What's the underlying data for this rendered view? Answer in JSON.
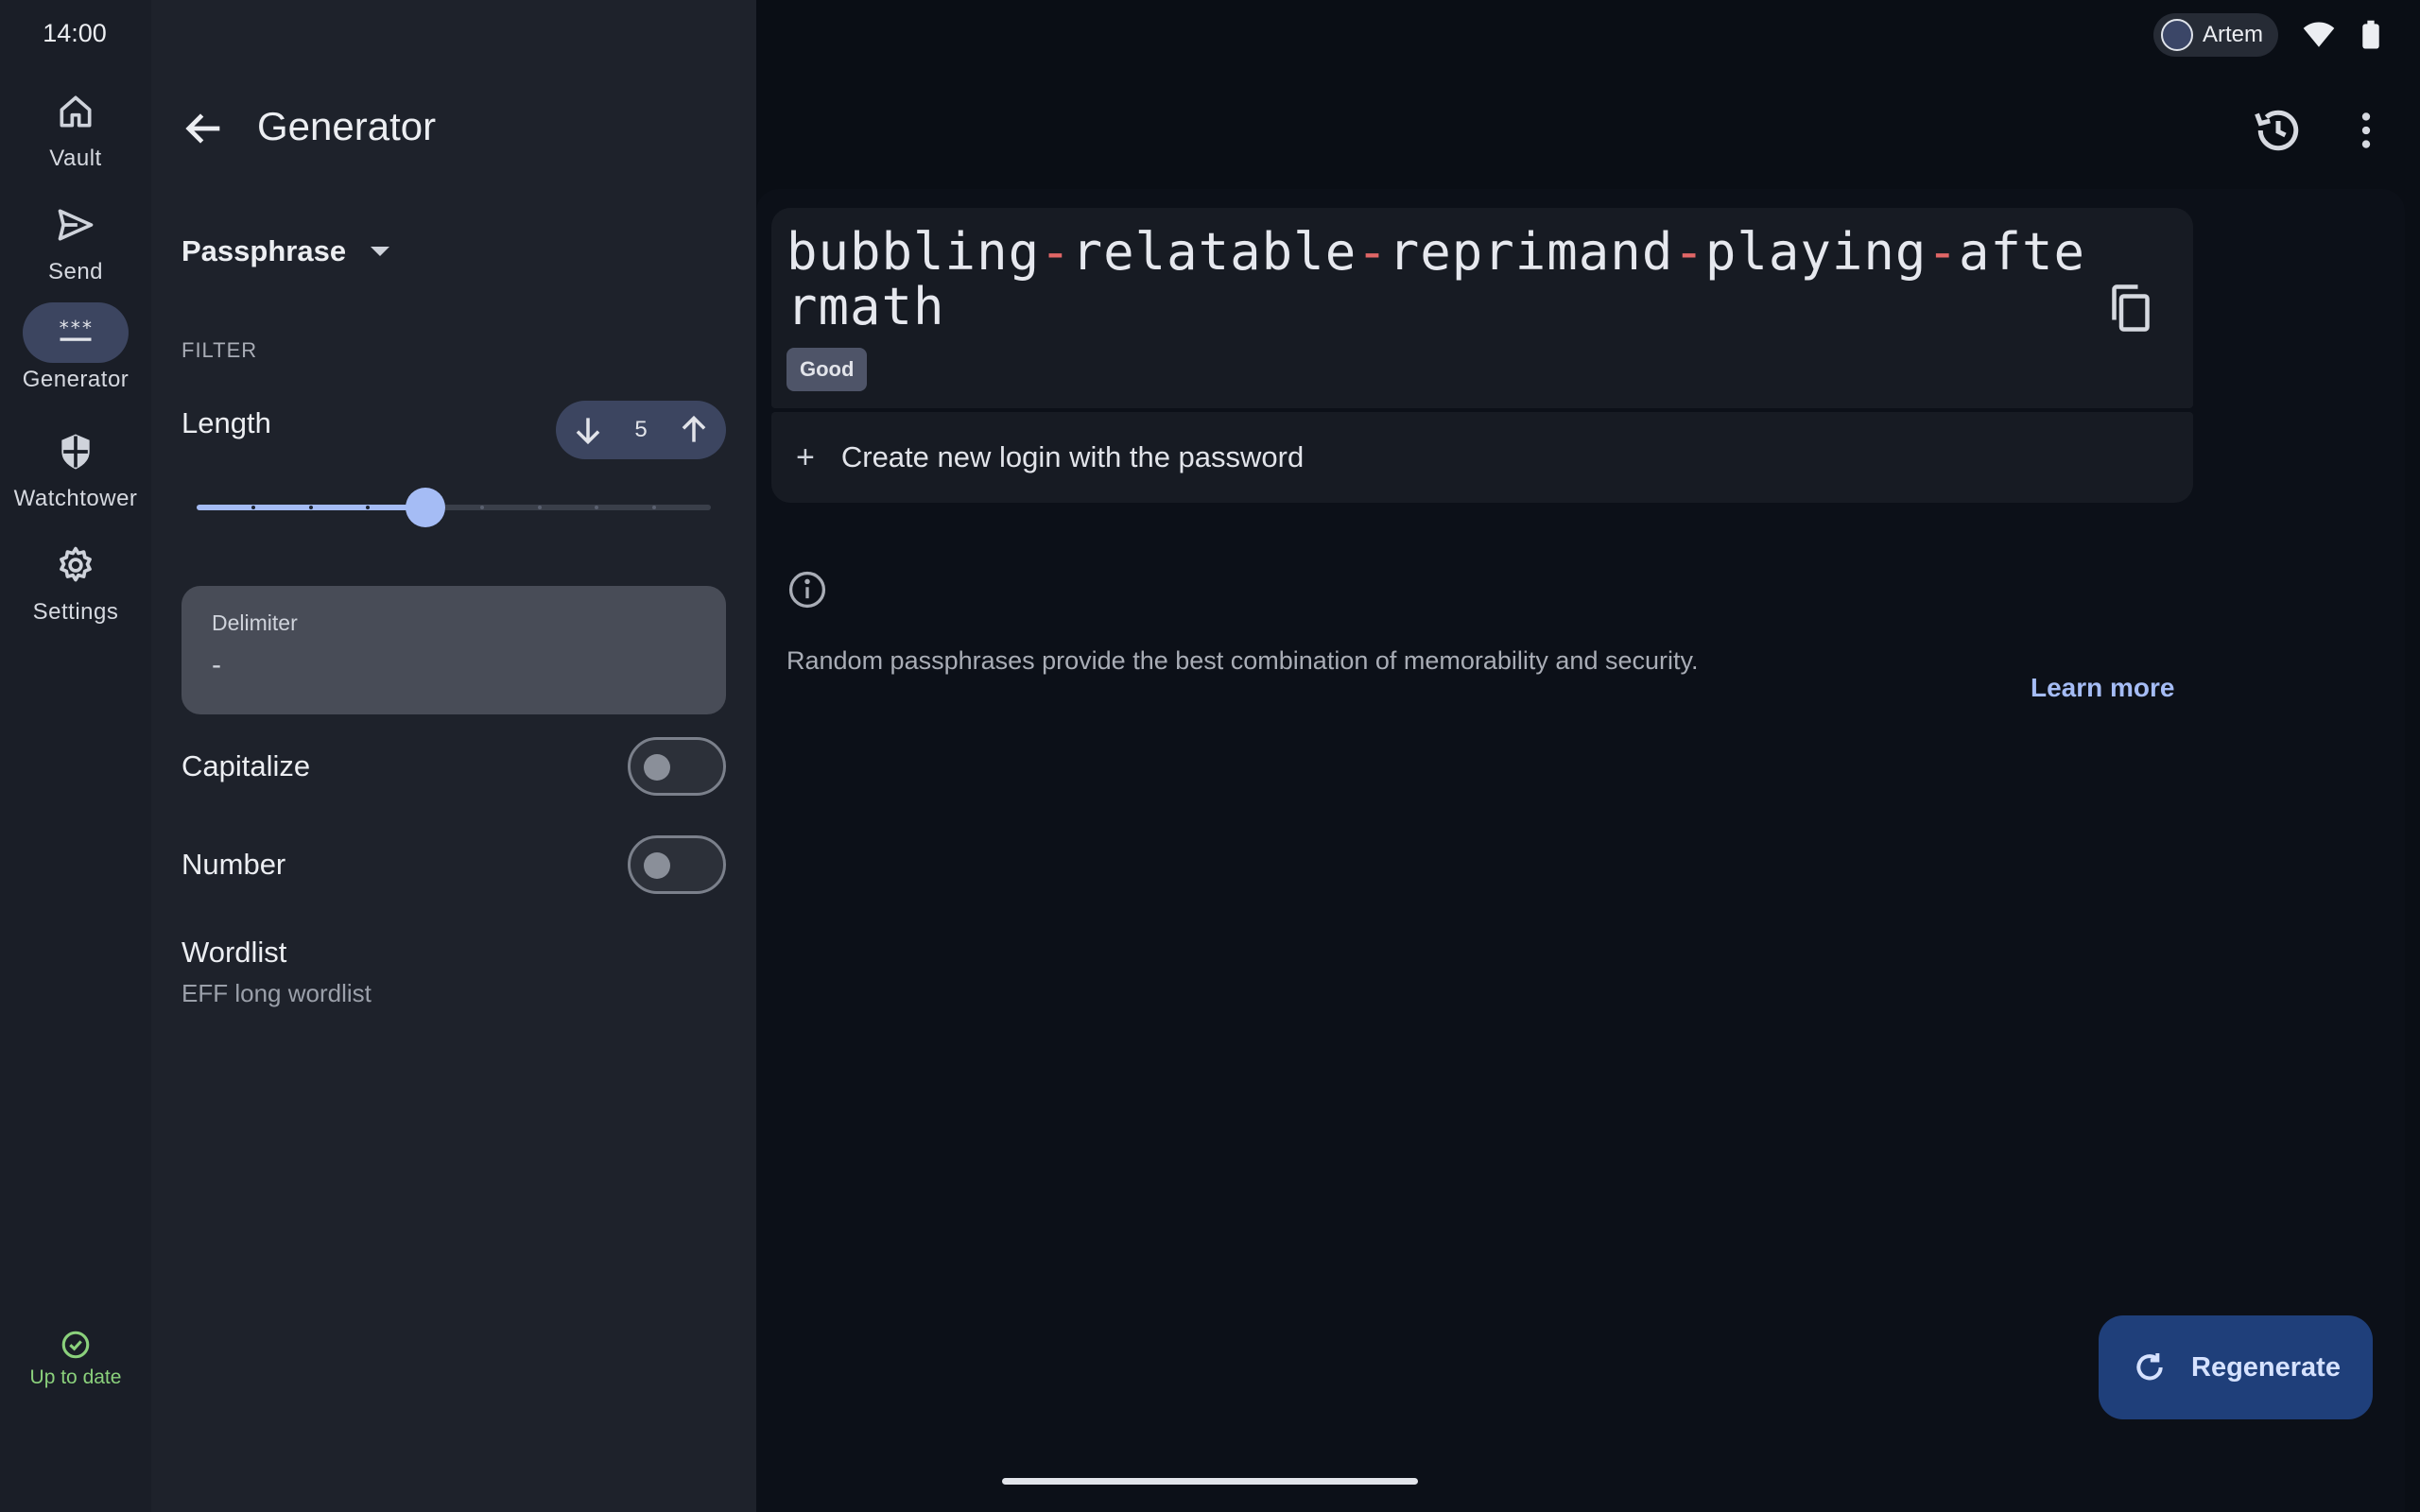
{
  "status_bar": {
    "time": "14:00",
    "user": "Artem"
  },
  "nav": {
    "items": [
      {
        "label": "Vault",
        "icon": "home-icon"
      },
      {
        "label": "Send",
        "icon": "send-icon"
      },
      {
        "label": "Generator",
        "icon": "password-icon",
        "active": true
      },
      {
        "label": "Watchtower",
        "icon": "shield-icon"
      },
      {
        "label": "Settings",
        "icon": "gear-icon"
      }
    ],
    "sync_status": "Up to date"
  },
  "header": {
    "title": "Generator"
  },
  "settings": {
    "type": "Passphrase",
    "filter_label": "FILTER",
    "length_label": "Length",
    "length_value": "5",
    "slider": {
      "min": 1,
      "max": 10,
      "value": 5
    },
    "delimiter": {
      "label": "Delimiter",
      "value": "-"
    },
    "capitalize": {
      "label": "Capitalize",
      "on": false
    },
    "number": {
      "label": "Number",
      "on": false
    },
    "wordlist": {
      "title": "Wordlist",
      "subtitle": "EFF long wordlist"
    }
  },
  "result": {
    "words": [
      "bubbling",
      "relatable",
      "reprimand",
      "playing",
      "aftermath"
    ],
    "separator": "-",
    "strength": "Good",
    "create_login": "Create new login with the password",
    "info": "Random passphrases provide the best combination of memorability and security.",
    "learn_more": "Learn more",
    "regenerate": "Regenerate"
  },
  "colors": {
    "accent": "#a5bcf5",
    "separator": "#e06666",
    "sync": "#8bd17c"
  }
}
